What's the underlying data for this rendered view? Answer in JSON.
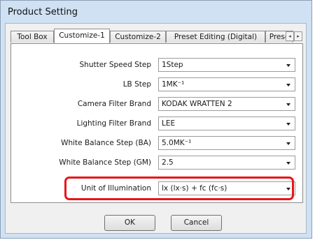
{
  "window": {
    "title": "Product Setting"
  },
  "tabs": [
    {
      "label": "Tool Box",
      "active": false
    },
    {
      "label": "Customize-1",
      "active": true
    },
    {
      "label": "Customize-2",
      "active": false
    },
    {
      "label": "Preset Editing (Digital)",
      "active": false
    },
    {
      "label": "Prese",
      "active": false
    }
  ],
  "tab_scroll": {
    "left": "◂",
    "right": "▸"
  },
  "settings": [
    {
      "label": "Shutter Speed Step",
      "value": "1Step"
    },
    {
      "label": "LB Step",
      "value": "1MK⁻¹"
    },
    {
      "label": "Camera Filter Brand",
      "value": "KODAK WRATTEN 2"
    },
    {
      "label": "Lighting Filter Brand",
      "value": "LEE"
    },
    {
      "label": "White Balance Step (BA)",
      "value": "5.0MK⁻¹"
    },
    {
      "label": "White Balance Step (GM)",
      "value": "2.5"
    },
    {
      "label": "Unit of Illumination",
      "value": "lx (lx·s) + fc (fc·s)"
    }
  ],
  "buttons": {
    "ok": "OK",
    "cancel": "Cancel"
  },
  "colors": {
    "highlight": "#e8141a",
    "frame": "#cfe1f3"
  }
}
